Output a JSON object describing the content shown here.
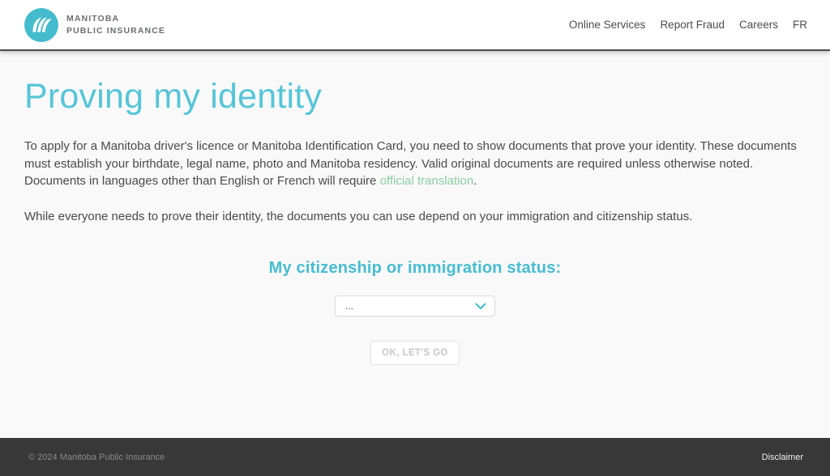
{
  "header": {
    "logo": {
      "line1": "MANITOBA",
      "line2": "PUBLIC INSURANCE"
    },
    "nav": [
      {
        "label": "Online Services"
      },
      {
        "label": "Report Fraud"
      },
      {
        "label": "Careers"
      },
      {
        "label": "FR"
      }
    ]
  },
  "main": {
    "title": "Proving my identity",
    "paragraph1_before_link": "To apply for a Manitoba driver's licence or Manitoba Identification Card, you need to show documents that prove your identity. These documents must establish your birthdate, legal name, photo and Manitoba residency. Valid original documents are required unless otherwise noted. Documents in languages other than English or French will require ",
    "paragraph1_link": "official translation",
    "paragraph1_after_link": ".",
    "paragraph2": "While everyone needs to prove their identity, the documents you can use depend on your immigration and citizenship status.",
    "status_heading": "My citizenship or immigration status:",
    "dropdown_value": "...",
    "ok_button_label": "OK, LET'S GO"
  },
  "footer": {
    "copyright": "© 2024 Manitoba Public Insurance",
    "disclaimer_label": "Disclaimer"
  },
  "colors": {
    "accent_teal": "#56c5d8",
    "logo_teal": "#45bccd",
    "link_green": "#8bcfa4",
    "footer_bg": "#383838",
    "header_border": "#4a4a4a"
  }
}
